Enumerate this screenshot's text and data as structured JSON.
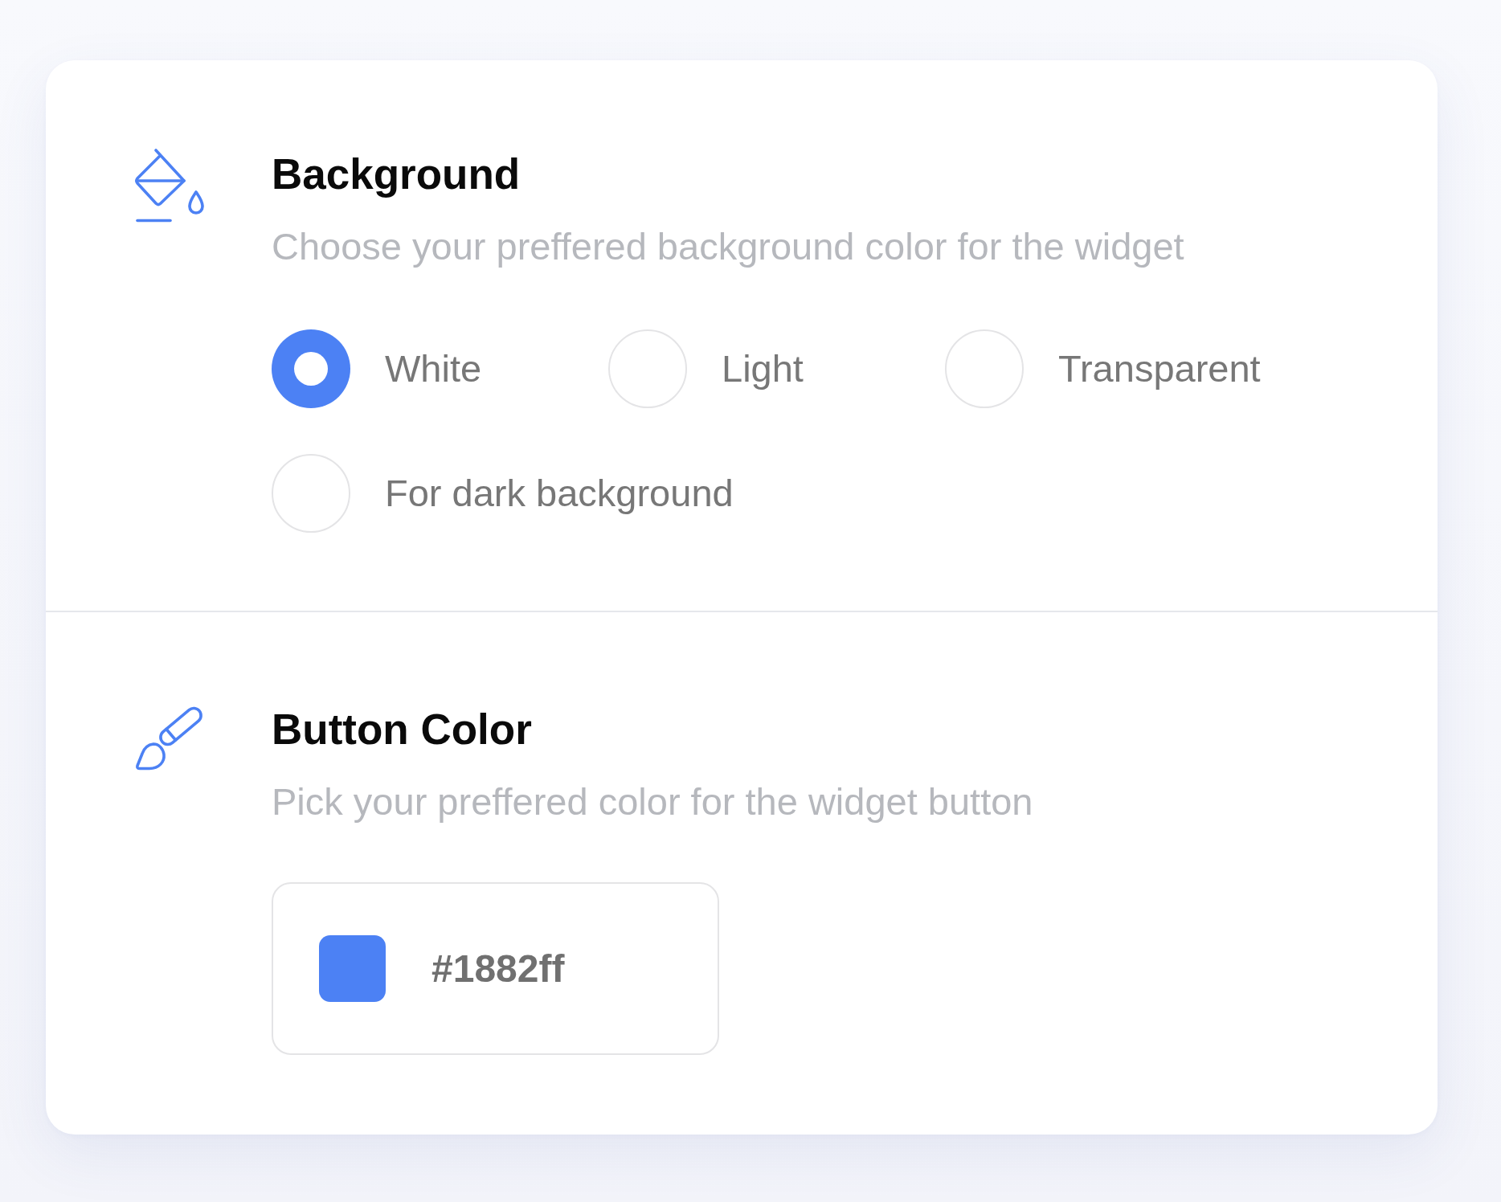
{
  "sections": [
    {
      "kind": "radio",
      "title": "Background",
      "description": "Choose your preffered background color for the widget",
      "options": [
        {
          "label": "White",
          "selected": true
        },
        {
          "label": "Light",
          "selected": false
        },
        {
          "label": "Transparent",
          "selected": false
        },
        {
          "label": "For dark background",
          "selected": false
        }
      ]
    },
    {
      "kind": "color",
      "title": "Button Color",
      "description": "Pick your preffered color for the widget button",
      "color_field": {
        "value": "#1882ff",
        "color": "#4c81f4"
      }
    }
  ]
}
